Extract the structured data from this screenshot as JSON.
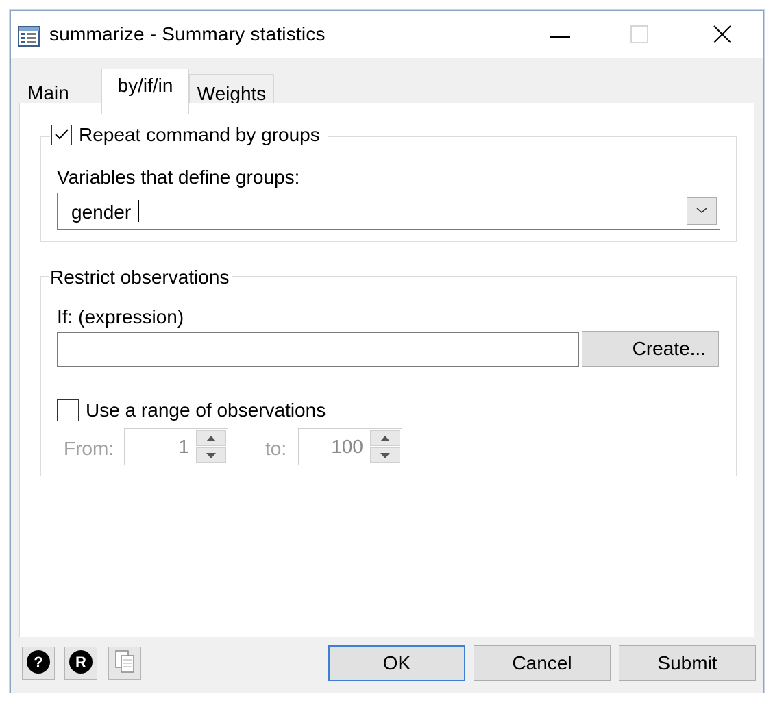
{
  "window": {
    "title": "summarize - Summary statistics",
    "icons": {
      "app": "dialog-list-icon",
      "minimize": "minimize-icon",
      "maximize": "maximize-icon",
      "close": "close-icon"
    }
  },
  "tabs": [
    {
      "label": "Main",
      "active": false
    },
    {
      "label": "by/if/in",
      "active": true
    },
    {
      "label": "Weights",
      "active": false
    }
  ],
  "by_group": {
    "checkbox_label": "Repeat command by groups",
    "checked": true,
    "variables_label": "Variables that define groups:",
    "variables_value": "gender"
  },
  "restrict": {
    "legend": "Restrict observations",
    "if_label": "If: (expression)",
    "if_value": "",
    "create_button": "Create...",
    "range_checkbox_label": "Use a range of observations",
    "range_checked": false,
    "from_label": "From:",
    "from_value": "1",
    "to_label": "to:",
    "to_value": "100"
  },
  "footer": {
    "help_icon": "help-icon",
    "reset_icon": "reset-icon",
    "copy_icon": "copy-icon",
    "ok": "OK",
    "cancel": "Cancel",
    "submit": "Submit"
  },
  "colors": {
    "accent_border": "#3c7fd4",
    "window_border": "#8aa6c4"
  }
}
